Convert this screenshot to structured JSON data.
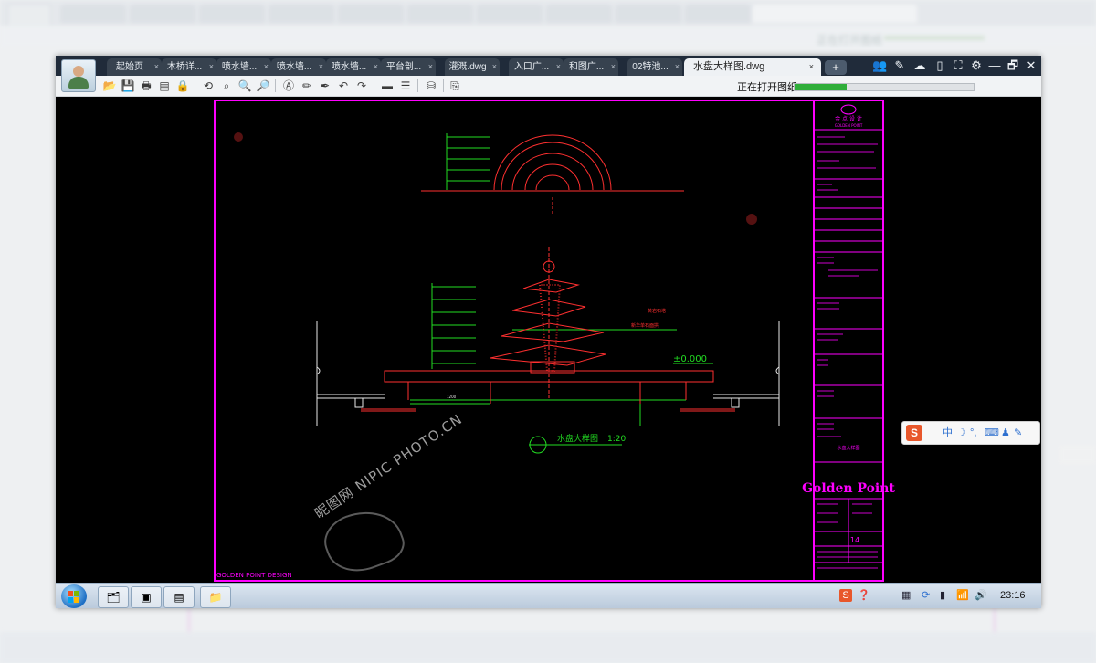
{
  "window": {
    "tabs": [
      {
        "label": "起始页"
      },
      {
        "label": "木桥详..."
      },
      {
        "label": "喷水墙..."
      },
      {
        "label": "喷水墙..."
      },
      {
        "label": "喷水墙..."
      },
      {
        "label": "平台剖..."
      },
      {
        "label": "灌溉.dwg"
      },
      {
        "label": "入口广..."
      },
      {
        "label": "和图广..."
      },
      {
        "label": "02特池..."
      }
    ],
    "active_tab": {
      "label": "水盘大样图.dwg",
      "close": "×"
    },
    "new_tab": "+",
    "window_controls": {
      "minimize": "—",
      "restore": "🗗",
      "close": "✕"
    }
  },
  "toolbar": {
    "status": "正在打开图纸",
    "progress": 0.29
  },
  "drawing": {
    "title": "水盘大样图",
    "scale": "1:20",
    "level_mark": "±0.000",
    "annotations": [
      "黄岩石塔",
      "新华单石面拱"
    ],
    "dimension_1": "1200",
    "footer_left": "GOLDEN POINT DESIGN",
    "titleblock": {
      "company": "金 点 设 计",
      "company_en": "GOLDEN POINT",
      "brand": "Golden Point",
      "sheet_no": "14",
      "drawing_name": "水盘大样图"
    }
  },
  "ime": {
    "mode": "中",
    "moon": "☽",
    "punct": "°,",
    "keyboard": "⌨",
    "person": "♟",
    "tools": "✎"
  },
  "taskbar": {
    "clock": "23:16"
  },
  "watermark": {
    "text": "昵图网 NIPIC PHOTO.CN"
  },
  "colors": {
    "cad_magenta": "#ff00ff",
    "cad_red": "#ff3030",
    "cad_green": "#22dd22",
    "cad_white": "#e8e8e8",
    "progress_green": "#2fae3a"
  }
}
